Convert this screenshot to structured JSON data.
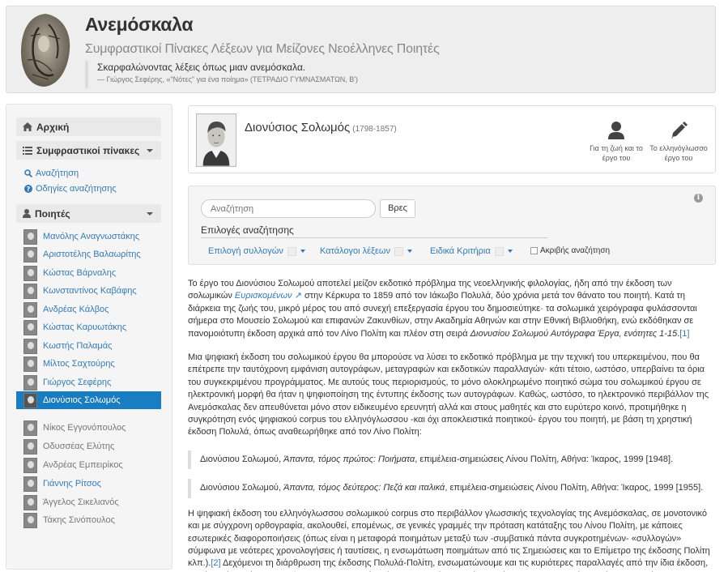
{
  "header": {
    "title": "Ανεμόσκαλα",
    "subtitle": "Συμφραστικοί Πίνακες Λέξεων για Μείζονες Νεοέλληνες Ποιητές",
    "quote_text": "Σκαρφαλώνοντας λέξεις όπως μιαν ανεμόσκαλα.",
    "quote_cite": "— Γιώργος Σεφέρης, «\"Νότες\" για ένα ποίημα» (ΤΕΤΡΑΔΙΟ ΓΥΜΝΑΣΜΑΤΩΝ, Β')"
  },
  "sidebar": {
    "home_label": "Αρχική",
    "tables_label": "Συμφραστικοί πίνακες",
    "search_label": "Αναζήτηση",
    "guide_label": "Οδηγίες αναζήτησης",
    "poets_label": "Ποιητές",
    "poets": [
      "Μανόλης Αναγνωστάκης",
      "Αριστοτέλης Βαλαωρίτης",
      "Κώστας Βάρναλης",
      "Κωνσταντίνος Καβάφης",
      "Ανδρέας Κάλβος",
      "Κώστας Καρυωτάκης",
      "Κωστής Παλαμάς",
      "Μίλτος Σαχτούρης",
      "Γιώργος Σεφέρης",
      "Διονύσιος Σολωμός"
    ],
    "poets_unavailable": [
      "Νίκος Εγγονόπουλος",
      "Οδυσσέας Ελύτης",
      "Ανδρέας Εμπειρίκος",
      "Γιάννης Ρίτσος",
      "Άγγελος Σικελιανός",
      "Τάκης Σινόπουλος"
    ]
  },
  "poet_card": {
    "name": "Διονύσιος Σολωμός",
    "years": "(1798-1857)",
    "life_label_1": "Για τη ζωή και το",
    "life_label_2": "έργο του",
    "corpus_label_1": "Το ελληνόγλωσσο",
    "corpus_label_2": "έργο του"
  },
  "search": {
    "placeholder": "Αναζήτηση",
    "button": "Βρες",
    "options_title": "Επιλογές αναζήτησης",
    "opt_collections": "Επιλογή συλλογών",
    "opt_wordlists": "Κατάλογοι λέξεων",
    "opt_criteria": "Ειδικά Κριτήρια",
    "opt_exact": "Ακριβής αναζήτηση"
  },
  "article": {
    "p1_a": "Το έργο του Διονύσιου Σολωμού αποτελεί μείζον εκδοτικό πρόβλημα της νεοελληνικής φιλολογίας, ήδη από την έκδοση των σολωμικών ",
    "p1_link": "Ευρισκομένων",
    "p1_b": " στην Κέρκυρα το 1859 από τον Ιάκωβο Πολυλά, δύο χρόνια μετά τον θάνατο του ποιητή. Κατά τη διάρκεια της ζωής του, μικρό μέρος του από συνεχή επεξεργασία έργου του δημοσιεύτηκε· τα σολωμικά χειρόγραφα φυλάσσονται σήμερα στο Μουσείο Σολωμού και επιφανών Ζακυνθίων, στην Ακαδημία Αθηνών και στην Εθνική Βιβλιοθήκη, ενώ εκδόθηκαν σε πανομοιότυπη έκδοση αρχικά από τον Λίνο Πολίτη και πλέον στη σειρά ",
    "p1_em": "Διονυσίου Σολωμού Αυτόγραφα Έργα, ενότητες 1-15",
    "p1_end": ".",
    "p1_ref": "[1]",
    "p2": "Μια ψηφιακή έκδοση του σολωμικού έργου θα μπορούσε να λύσει το εκδοτικό πρόβλημα με την τεχνική του υπερκειμένου, που θα επέτρεπε την ταυτόχρονη εμφάνιση αυτογράφων, μεταγραφών και εκδοτικών παραλλαγών· κάτι τέτοιο, ωστόσο, υπερβαίνει τα όρια του συγκεκριμένου προγράμματος. Με αυτούς τους περιορισμούς, το μόνο ολοκληρωμένο ποιητικό σώμα του σολωμικού έργου σε ηλεκτρονική μορφή θα ήταν η ψηφιοποίηση της έντυπης έκδοσης των αυτογράφων. Καθώς, ωστόσο, το ηλεκτρονικό περιβάλλον της Ανεμόσκαλας δεν απευθύνεται μόνο στον ειδικευμένο ερευνητή αλλά και στους μαθητές και στο ευρύτερο κοινό, προτιμήθηκε η συγκρότηση ενός ψηφιακού corpus του ελληνόγλωσσου -και όχι αποκλειστικά ποιητικού- έργου του ποιητή, με βάση τη χρηστική έκδοση Πολυλά, όπως αναθεωρήθηκε από τον Λίνο Πολίτη:",
    "q1_a": "Διονύσιου Σολωμού, ",
    "q1_em": "Άπαντα, τόμος πρώτος: Ποιήματα",
    "q1_b": ", επιμέλεια-σημειώσεις Λίνου Πολίτη, Αθήνα: Ίκαρος, 1999 [1948].",
    "q2_a": "Διονύσιου Σολωμού, ",
    "q2_em": "Άπαντα, τόμος δεύτερος: Πεζά και ιταλικά",
    "q2_b": ", επιμέλεια-σημειώσεις Λίνου Πολίτη, Αθήνα: Ίκαρος, 1999 [1955].",
    "p3_a": "Η ψηφιακή έκδοση του ελληνόγλωσσου σολωμικού corpus στο περιβάλλον γλωσσικής τεχνολογίας της Ανεμόσκαλας, σε μονοτονικό και με σύγχρονη ορθογραφία, ακολουθεί, επομένως, σε γενικές γραμμές την πρόταση κατάταξης του Λίνου Πολίτη, με κάποιες εσωτερικές διαφοροποιήσεις (όπως είναι η μεταφορά ποιημάτων μεταξύ των -συμβατικά πάντα συγκροτημένων- «συλλογών» σύμφωνα με νεότερες χρονολογήσεις ή ταυτίσεις, η ενσωμάτωση ποιημάτων από τις Σημειώσεις και το Επίμετρο της έκδοσης Πολίτη κλπ.).",
    "p3_ref": "[2]",
    "p3_b": " Δεχόμενοι τη διάρθρωση της έκδοσης Πολυλά-Πολίτη, ενσωματώνουμε και τις κυριότερες παραλλαγές από την ίδια έκδοση, καθώς στόχος είναι η αναζήτηση να περιλαμβάνει όσο το δυνατόν μεγαλύτερο μέρος του γλωσσικού υλικού του ελληνόγλωσσου"
  },
  "colors": {
    "link": "#337ab7",
    "active_item": "#1a7cc1",
    "panel_bg": "#f5f5f5"
  }
}
